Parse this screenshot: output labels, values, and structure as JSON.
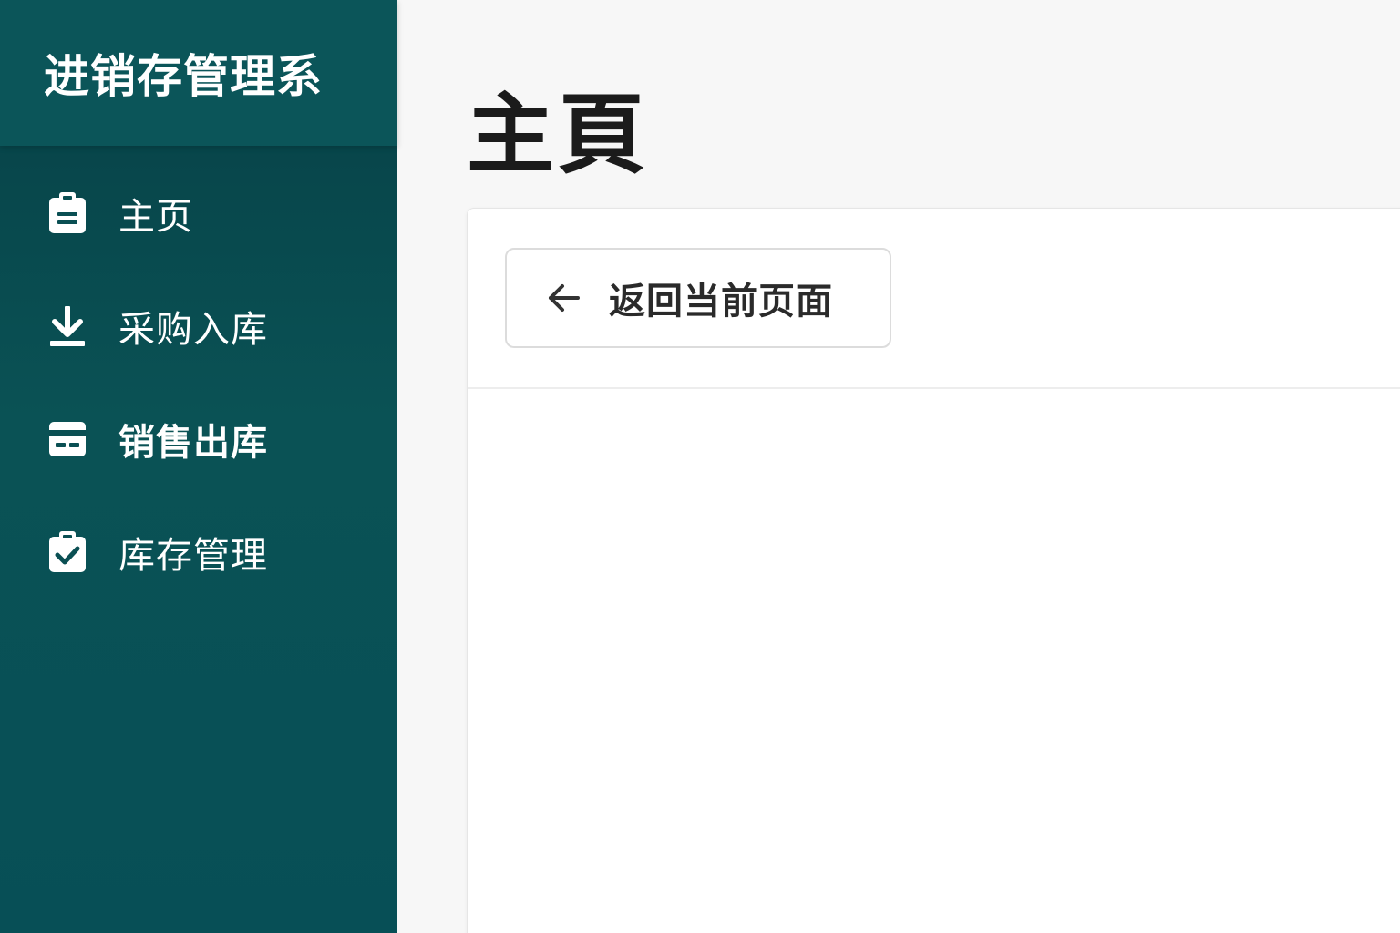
{
  "sidebar": {
    "title": "进销存管理系",
    "items": [
      {
        "label": "主页",
        "icon": "clipboard-icon"
      },
      {
        "label": "采购入库",
        "icon": "download-icon"
      },
      {
        "label": "销售出库",
        "icon": "card-icon"
      },
      {
        "label": "库存管理",
        "icon": "clipboard-check-icon"
      }
    ]
  },
  "main": {
    "page_title": "主頁",
    "back_button": {
      "label": "返回当前页面",
      "icon": "arrow-left-icon"
    }
  },
  "colors": {
    "sidebar": "#0a5255",
    "sidebar_header": "#0b5559",
    "background": "#f7f7f7",
    "card": "#ffffff"
  }
}
